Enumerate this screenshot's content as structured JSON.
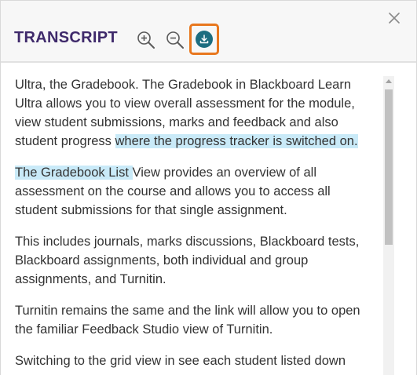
{
  "header": {
    "title": "TRANSCRIPT"
  },
  "toolbar": {
    "zoom_in_icon": "zoom-in-icon",
    "zoom_out_icon": "zoom-out-icon",
    "download_icon": "download-icon",
    "close_icon": "close-icon"
  },
  "colors": {
    "title": "#3f2a6b",
    "download": "#1d6d80",
    "download_highlight_border": "#e8771e",
    "text_highlight": "#c9eaf8"
  },
  "transcript": {
    "p1_text": "Ultra, the Gradebook. The Gradebook in Blackboard Learn Ultra allows you to view overall assessment for the module, view student submissions, marks and feedback and also student progress ",
    "p1_highlight": "where the progress tracker is switched on.",
    "p2_highlight": "The Gradebook List ",
    "p2_text": "View provides an overview of all assessment on the course and allows you to access all student submissions for that single assignment.",
    "p3_text": "This includes journals, marks discussions, Blackboard tests, Blackboard assignments, both individual and group assignments, and Turnitin.",
    "p4_text": "Turnitin remains the same and the link will allow you to open the familiar Feedback Studio view of Turnitin.",
    "p5_text": "Switching to the grid view in see each student listed down"
  }
}
